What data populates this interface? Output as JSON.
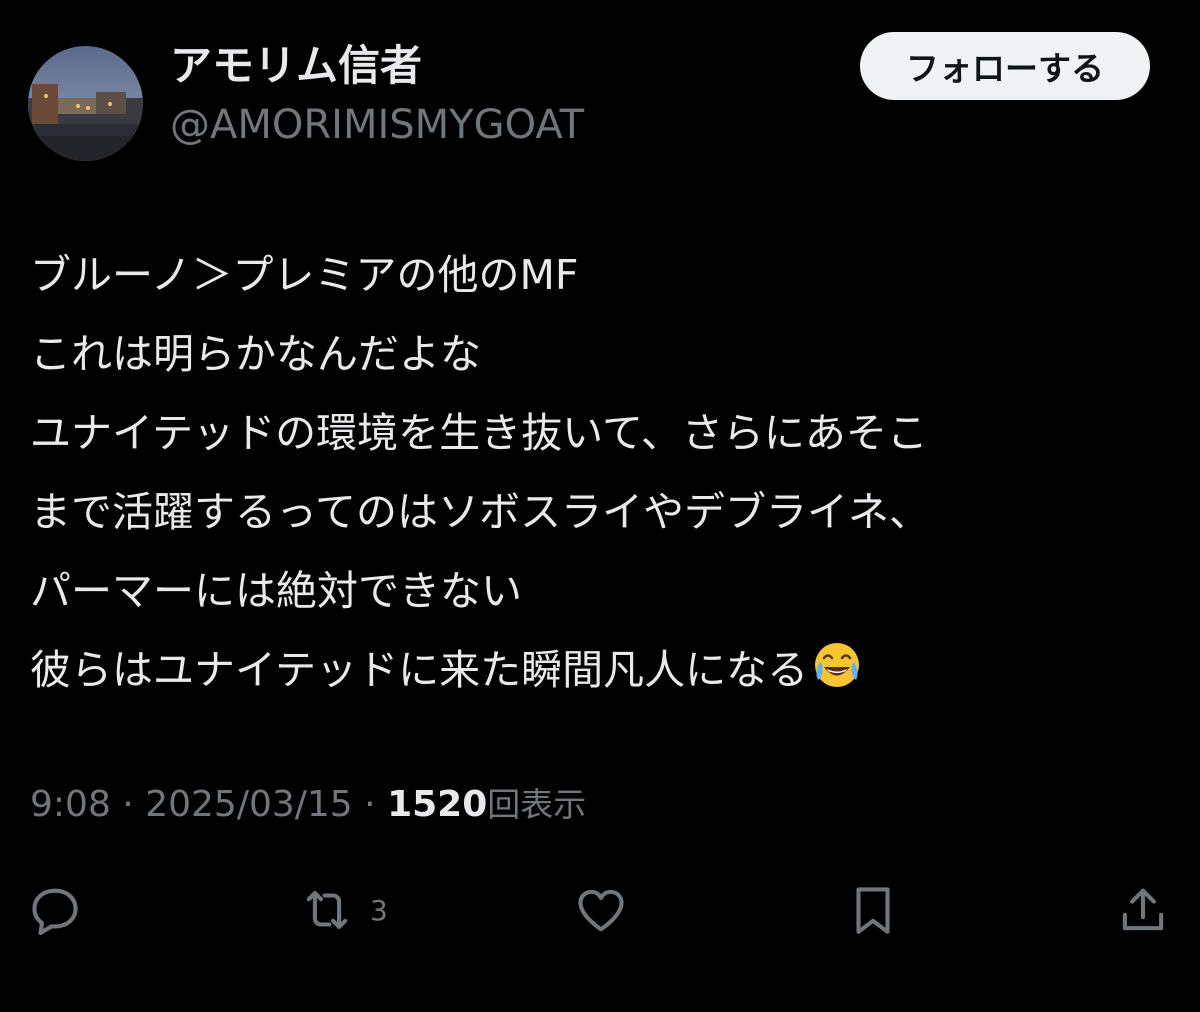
{
  "user": {
    "display_name": "アモリム信者",
    "handle": "@AMORIMISMYGOAT"
  },
  "follow_button": {
    "label": "フォローする"
  },
  "tweet": {
    "lines": [
      "ブルーノ＞プレミアの他のMF",
      "これは明らかなんだよな",
      "ユナイテッドの環境を生き抜いて、さらにあそこ",
      "まで活躍するってのはソボスライやデブライネ、",
      "パーマーには絶対できない",
      "彼らはユナイテッドに来た瞬間凡人になる"
    ],
    "trailing_emoji": "face-with-tears-of-joy"
  },
  "meta": {
    "time": "9:08",
    "separator": "·",
    "date": "2025/03/15",
    "views_count": "1520",
    "views_label": "回表示"
  },
  "actions": {
    "reply_icon": "speech-bubble-icon",
    "retweet_icon": "retweet-icon",
    "retweet_count": "3",
    "like_icon": "heart-icon",
    "bookmark_icon": "bookmark-icon",
    "share_icon": "share-icon"
  },
  "colors": {
    "background": "#000000",
    "primary_text": "#e7e9ea",
    "secondary_text": "#71767b",
    "follow_button_bg": "#eff3f4"
  }
}
